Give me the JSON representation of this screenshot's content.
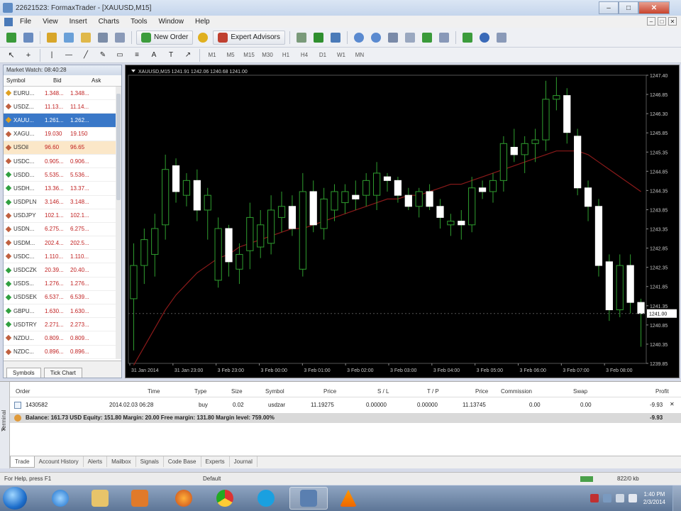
{
  "window": {
    "title": "22621523: FormaxTrader - [XAUUSD,M15]",
    "controls": {
      "minimize": "–",
      "maximize": "□",
      "close": "✕"
    }
  },
  "menu": [
    "File",
    "View",
    "Insert",
    "Charts",
    "Tools",
    "Window",
    "Help"
  ],
  "toolbar": {
    "new_order": "New Order",
    "expert_advisors": "Expert Advisors",
    "timeframes": [
      "M1",
      "M5",
      "M15",
      "M30",
      "H1",
      "H4",
      "D1",
      "W1",
      "MN"
    ]
  },
  "market_watch": {
    "header": "Market Watch: 08:40:28",
    "columns": [
      "Symbol",
      "Bid",
      "Ask"
    ],
    "rows": [
      {
        "symbol": "EURU...",
        "bid": "1.348...",
        "ask": "1.348...",
        "state": "normal",
        "dot": "#e0a020"
      },
      {
        "symbol": "USDZ...",
        "bid": "11.13...",
        "ask": "11.14...",
        "state": "normal",
        "dot": "#c06040"
      },
      {
        "symbol": "XAUU...",
        "bid": "1.261...",
        "ask": "1.262...",
        "state": "selected",
        "dot": "#e0a020"
      },
      {
        "symbol": "XAGU...",
        "bid": "19.030",
        "ask": "19.150",
        "state": "normal",
        "dot": "#c06040"
      },
      {
        "symbol": "USOil",
        "bid": "96.60",
        "ask": "96.65",
        "state": "highlight",
        "dot": "#c06040"
      },
      {
        "symbol": "USDC...",
        "bid": "0.905...",
        "ask": "0.906...",
        "state": "normal",
        "dot": "#c06040"
      },
      {
        "symbol": "USDD...",
        "bid": "5.535...",
        "ask": "5.536...",
        "state": "normal",
        "dot": "#30a040"
      },
      {
        "symbol": "USDH...",
        "bid": "13.36...",
        "ask": "13.37...",
        "state": "normal",
        "dot": "#30a040"
      },
      {
        "symbol": "USDPLN",
        "bid": "3.146...",
        "ask": "3.148...",
        "state": "normal",
        "dot": "#30a040"
      },
      {
        "symbol": "USDJPY",
        "bid": "102.1...",
        "ask": "102.1...",
        "state": "normal",
        "dot": "#c06040"
      },
      {
        "symbol": "USDN...",
        "bid": "6.275...",
        "ask": "6.275...",
        "state": "normal",
        "dot": "#c06040"
      },
      {
        "symbol": "USDM...",
        "bid": "202.4...",
        "ask": "202.5...",
        "state": "normal",
        "dot": "#c06040"
      },
      {
        "symbol": "USDC...",
        "bid": "1.110...",
        "ask": "1.110...",
        "state": "normal",
        "dot": "#c06040"
      },
      {
        "symbol": "USDCZK",
        "bid": "20.39...",
        "ask": "20.40...",
        "state": "normal",
        "dot": "#30a040"
      },
      {
        "symbol": "USDS...",
        "bid": "1.276...",
        "ask": "1.276...",
        "state": "normal",
        "dot": "#30a040"
      },
      {
        "symbol": "USDSEK",
        "bid": "6.537...",
        "ask": "6.539...",
        "state": "normal",
        "dot": "#30a040"
      },
      {
        "symbol": "GBPU...",
        "bid": "1.630...",
        "ask": "1.630...",
        "state": "normal",
        "dot": "#30a040"
      },
      {
        "symbol": "USDTRY",
        "bid": "2.271...",
        "ask": "2.273...",
        "state": "normal",
        "dot": "#30a040"
      },
      {
        "symbol": "NZDU...",
        "bid": "0.809...",
        "ask": "0.809...",
        "state": "normal",
        "dot": "#c06040"
      },
      {
        "symbol": "NZDC...",
        "bid": "0.896...",
        "ask": "0.896...",
        "state": "normal",
        "dot": "#c06040"
      }
    ],
    "tabs": [
      "Symbols",
      "Tick Chart"
    ]
  },
  "chart": {
    "header": "XAUUSD,M15  1241.91 1242.06 1240.68 1241.00",
    "price_tag": "1241.00",
    "colors": {
      "background": "#000000",
      "bull": "#000000",
      "bear": "#ffffff",
      "wick": "#2f9e2f",
      "ma": "#8b1a1a",
      "grid": "#1f3f1f",
      "axis_text": "#c8c8c8"
    }
  },
  "chart_data": {
    "type": "candlestick",
    "symbol": "XAUUSD",
    "timeframe": "M15",
    "ylim": [
      1239.65,
      1247.45
    ],
    "y_ticks": [
      "1247.40",
      "1246.85",
      "1246.30",
      "1245.85",
      "1245.35",
      "1244.85",
      "1244.35",
      "1243.85",
      "1243.35",
      "1242.85",
      "1242.35",
      "1241.85",
      "1241.35",
      "1240.85",
      "1240.35",
      "1239.85"
    ],
    "x_ticks": [
      "31 Jan 2014",
      "31 Jan 23:00",
      "3 Feb 23:00",
      "3 Feb 00:00",
      "3 Feb 01:00",
      "3 Feb 02:00",
      "3 Feb 03:00",
      "3 Feb 04:00",
      "3 Feb 05:00",
      "3 Feb 06:00",
      "3 Feb 07:00",
      "3 Feb 08:00"
    ],
    "candles": [
      {
        "o": 1241.4,
        "h": 1242.9,
        "l": 1240.0,
        "c": 1242.3
      },
      {
        "o": 1242.3,
        "h": 1243.3,
        "l": 1241.8,
        "c": 1243.0
      },
      {
        "o": 1242.6,
        "h": 1243.7,
        "l": 1242.0,
        "c": 1243.3
      },
      {
        "o": 1243.4,
        "h": 1245.3,
        "l": 1243.0,
        "c": 1244.9
      },
      {
        "o": 1245.0,
        "h": 1245.2,
        "l": 1244.0,
        "c": 1244.3
      },
      {
        "o": 1244.2,
        "h": 1244.8,
        "l": 1243.9,
        "c": 1244.6
      },
      {
        "o": 1244.6,
        "h": 1244.9,
        "l": 1243.5,
        "c": 1243.8
      },
      {
        "o": 1243.8,
        "h": 1244.4,
        "l": 1243.0,
        "c": 1244.2
      },
      {
        "o": 1241.9,
        "h": 1243.6,
        "l": 1241.7,
        "c": 1243.3
      },
      {
        "o": 1243.3,
        "h": 1243.4,
        "l": 1242.0,
        "c": 1242.4
      },
      {
        "o": 1242.2,
        "h": 1242.9,
        "l": 1241.8,
        "c": 1242.6
      },
      {
        "o": 1242.7,
        "h": 1244.0,
        "l": 1242.2,
        "c": 1243.6
      },
      {
        "o": 1242.8,
        "h": 1243.8,
        "l": 1242.5,
        "c": 1243.4
      },
      {
        "o": 1242.9,
        "h": 1244.2,
        "l": 1242.6,
        "c": 1243.8
      },
      {
        "o": 1243.6,
        "h": 1244.3,
        "l": 1243.2,
        "c": 1243.9
      },
      {
        "o": 1243.9,
        "h": 1244.2,
        "l": 1243.1,
        "c": 1243.3
      },
      {
        "o": 1242.2,
        "h": 1244.8,
        "l": 1242.0,
        "c": 1244.3
      },
      {
        "o": 1244.3,
        "h": 1244.6,
        "l": 1243.2,
        "c": 1243.4
      },
      {
        "o": 1243.3,
        "h": 1244.4,
        "l": 1243.0,
        "c": 1244.1
      },
      {
        "o": 1243.8,
        "h": 1244.5,
        "l": 1243.5,
        "c": 1244.3
      },
      {
        "o": 1244.0,
        "h": 1244.5,
        "l": 1243.7,
        "c": 1244.3
      },
      {
        "o": 1244.2,
        "h": 1244.6,
        "l": 1243.8,
        "c": 1244.1
      },
      {
        "o": 1244.2,
        "h": 1244.8,
        "l": 1243.9,
        "c": 1244.6
      },
      {
        "o": 1244.2,
        "h": 1245.1,
        "l": 1243.8,
        "c": 1244.8
      },
      {
        "o": 1244.7,
        "h": 1244.8,
        "l": 1244.3,
        "c": 1244.6
      },
      {
        "o": 1244.6,
        "h": 1244.7,
        "l": 1244.0,
        "c": 1244.2
      },
      {
        "o": 1244.2,
        "h": 1244.4,
        "l": 1243.8,
        "c": 1243.9
      },
      {
        "o": 1243.9,
        "h": 1244.4,
        "l": 1243.6,
        "c": 1244.3
      },
      {
        "o": 1244.3,
        "h": 1244.5,
        "l": 1243.8,
        "c": 1243.9
      },
      {
        "o": 1243.9,
        "h": 1244.1,
        "l": 1243.3,
        "c": 1243.6
      },
      {
        "o": 1243.4,
        "h": 1243.7,
        "l": 1243.1,
        "c": 1243.5
      },
      {
        "o": 1243.5,
        "h": 1243.8,
        "l": 1243.0,
        "c": 1243.4
      },
      {
        "o": 1243.4,
        "h": 1244.7,
        "l": 1243.2,
        "c": 1244.4
      },
      {
        "o": 1244.4,
        "h": 1244.6,
        "l": 1244.1,
        "c": 1244.3
      },
      {
        "o": 1244.3,
        "h": 1244.8,
        "l": 1244.0,
        "c": 1244.6
      },
      {
        "o": 1244.6,
        "h": 1245.8,
        "l": 1244.3,
        "c": 1245.6
      },
      {
        "o": 1245.5,
        "h": 1246.0,
        "l": 1245.1,
        "c": 1245.3
      },
      {
        "o": 1245.3,
        "h": 1245.8,
        "l": 1244.8,
        "c": 1245.6
      },
      {
        "o": 1245.6,
        "h": 1246.0,
        "l": 1245.1,
        "c": 1245.7
      },
      {
        "o": 1245.7,
        "h": 1247.3,
        "l": 1245.4,
        "c": 1246.8
      },
      {
        "o": 1246.8,
        "h": 1247.4,
        "l": 1246.5,
        "c": 1246.9
      },
      {
        "o": 1246.9,
        "h": 1247.1,
        "l": 1245.6,
        "c": 1245.9
      },
      {
        "o": 1245.8,
        "h": 1246.0,
        "l": 1244.2,
        "c": 1244.4
      },
      {
        "o": 1244.4,
        "h": 1244.6,
        "l": 1243.5,
        "c": 1243.9
      },
      {
        "o": 1243.9,
        "h": 1244.1,
        "l": 1242.0,
        "c": 1242.3
      },
      {
        "o": 1242.4,
        "h": 1242.6,
        "l": 1240.8,
        "c": 1241.1
      },
      {
        "o": 1241.1,
        "h": 1242.6,
        "l": 1240.9,
        "c": 1242.3
      },
      {
        "o": 1242.3,
        "h": 1242.6,
        "l": 1241.0,
        "c": 1241.3
      },
      {
        "o": 1241.3,
        "h": 1241.4,
        "l": 1240.1,
        "c": 1241.0
      }
    ],
    "moving_average": [
      1239.6,
      1240.1,
      1240.6,
      1241.1,
      1241.5,
      1241.8,
      1242.1,
      1242.3,
      1242.5,
      1242.6,
      1242.8,
      1242.9,
      1243.0,
      1243.1,
      1243.2,
      1243.3,
      1243.3,
      1243.4,
      1243.5,
      1243.6,
      1243.7,
      1243.8,
      1243.9,
      1244.0,
      1244.1,
      1244.1,
      1244.2,
      1244.2,
      1244.3,
      1244.4,
      1244.5,
      1244.5,
      1244.6,
      1244.7,
      1244.8,
      1244.9,
      1245.0,
      1245.1,
      1245.2,
      1245.3,
      1245.4,
      1245.4,
      1245.4,
      1245.3,
      1245.1,
      1244.9,
      1244.7,
      1244.5,
      1244.3
    ]
  },
  "terminal": {
    "side_label": "Terminal",
    "columns": [
      "Order",
      "Time",
      "Type",
      "Size",
      "Symbol",
      "Price",
      "S / L",
      "T / P",
      "Price",
      "Commission",
      "Swap",
      "Profit"
    ],
    "rows": [
      {
        "order": "1430582",
        "time": "2014.02.03 06:28",
        "type": "buy",
        "size": "0.02",
        "symbol": "usdzar",
        "price": "11.19275",
        "sl": "0.00000",
        "tp": "0.00000",
        "cur_price": "11.13745",
        "commission": "0.00",
        "swap": "0.00",
        "profit": "-9.93"
      }
    ],
    "balance_line": "Balance: 161.73 USD  Equity: 151.80  Margin: 20.00  Free margin: 131.80  Margin level: 759.00%",
    "balance_profit": "-9.93",
    "tabs": [
      "Trade",
      "Account History",
      "Alerts",
      "Mailbox",
      "Signals",
      "Code Base",
      "Experts",
      "Journal"
    ]
  },
  "status": {
    "help": "For Help, press F1",
    "profile": "Default",
    "traffic": "822/0 kb"
  },
  "taskbar": {
    "time": "1:40 PM",
    "date": "2/3/2014",
    "apps": [
      "internet-explorer",
      "file-explorer",
      "media-player",
      "firefox",
      "chrome",
      "skype",
      "formax-trader",
      "vlc"
    ]
  }
}
